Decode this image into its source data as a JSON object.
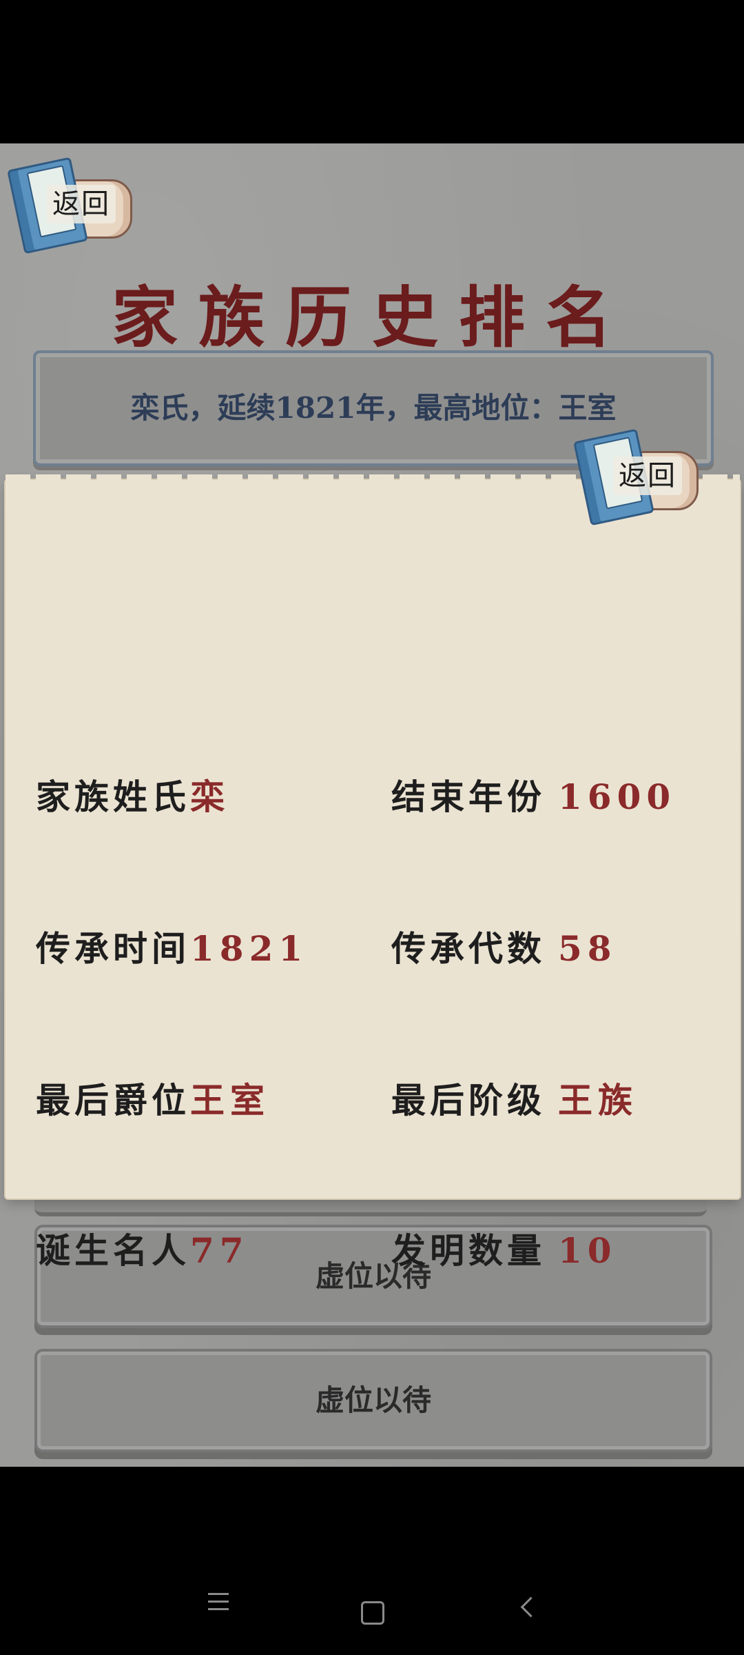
{
  "header": {
    "back_label": "返回",
    "title": "家族历史排名"
  },
  "summary": {
    "text": "栾氏，延续1821年，最高地位：王室"
  },
  "list": {
    "slots": [
      {
        "label": "虚位以待"
      },
      {
        "label": "虚位以待"
      }
    ]
  },
  "popup": {
    "back_label": "返回",
    "stats": {
      "surname_label": "家族姓氏",
      "surname_value": "栾",
      "end_year_label": "结束年份",
      "end_year_value": "1600",
      "duration_label": "传承时间",
      "duration_value": "1821",
      "generations_label": "传承代数",
      "generations_value": "58",
      "last_title_label": "最后爵位",
      "last_title_value": "王室",
      "last_class_label": "最后阶级",
      "last_class_value": "王族",
      "celebrities_label": "诞生名人",
      "celebrities_value": "77",
      "inventions_label": "发明数量",
      "inventions_value": "10"
    }
  },
  "colors": {
    "title": "#6b1c1c",
    "value": "#8a2a2a",
    "paper": "#ebe3d2",
    "summary_text": "#2d3d57"
  },
  "icons": [
    "book-scroll-icon",
    "menu-icon",
    "home-icon",
    "back-icon"
  ]
}
